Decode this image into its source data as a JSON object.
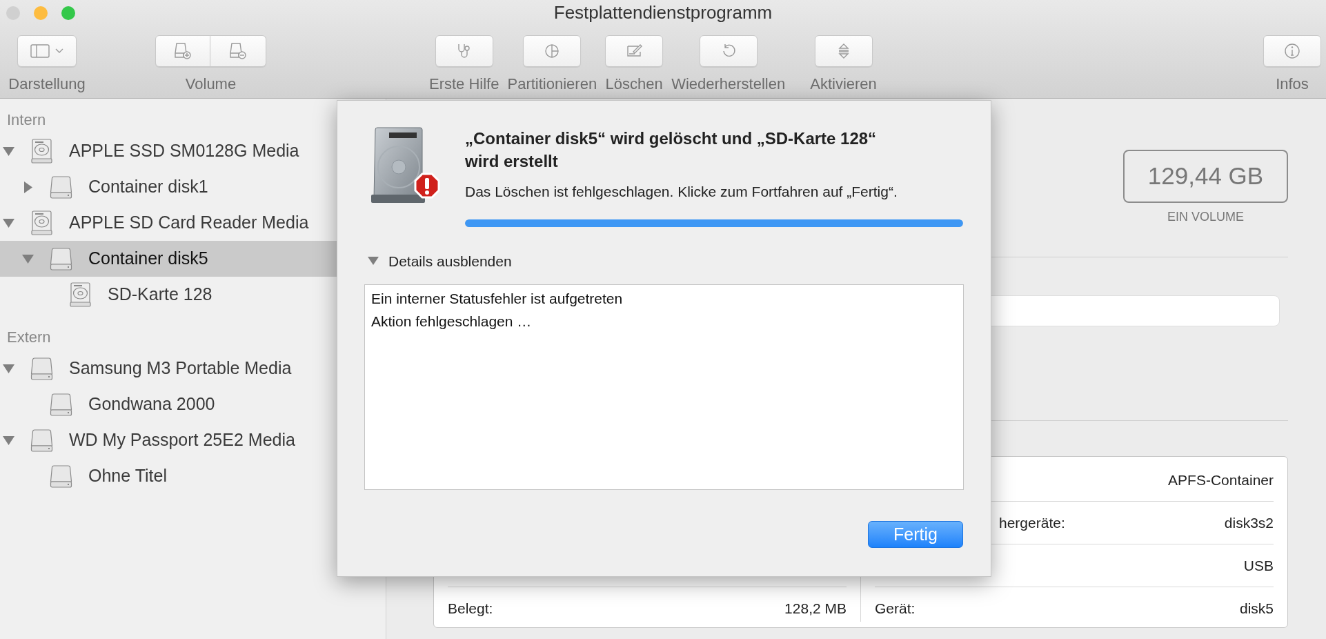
{
  "window": {
    "title": "Festplattendienstprogramm",
    "controls": [
      {
        "color": "#d0d0d0"
      },
      {
        "color": "#fdbc40"
      },
      {
        "color": "#34c84a"
      }
    ]
  },
  "toolbar": {
    "left": [
      {
        "label": "Darstellung",
        "kind": "sidebar"
      },
      {
        "label": "Volume",
        "kind": "volume"
      }
    ],
    "center": [
      {
        "label": "Erste Hilfe",
        "kind": "first-aid"
      },
      {
        "label": "Partitionieren",
        "kind": "partition"
      },
      {
        "label": "Löschen",
        "kind": "erase"
      },
      {
        "label": "Wiederherstellen",
        "kind": "restore"
      },
      {
        "label": "Aktivieren",
        "kind": "mount"
      }
    ],
    "right": [
      {
        "label": "Infos",
        "kind": "info"
      }
    ]
  },
  "sidebar": {
    "sections": [
      {
        "title": "Intern",
        "items": [
          {
            "name": "APPLE SSD SM0128G Media",
            "kind": "disk",
            "selected": false,
            "expanded": true,
            "children": [
              {
                "name": "Container disk1",
                "kind": "volume",
                "selected": false,
                "expanded": false
              }
            ]
          },
          {
            "name": "APPLE SD Card Reader Media",
            "kind": "disk",
            "selected": false,
            "expanded": true,
            "children": [
              {
                "name": "Container disk5",
                "kind": "volume",
                "selected": true,
                "expanded": true,
                "children": [
                  {
                    "name": "SD-Karte 128",
                    "kind": "disk",
                    "selected": false
                  }
                ]
              }
            ]
          }
        ]
      },
      {
        "title": "Extern",
        "items": [
          {
            "name": "Samsung M3 Portable Media",
            "kind": "volume",
            "selected": false,
            "expanded": true,
            "children": [
              {
                "name": "Gondwana 2000",
                "kind": "volume",
                "selected": false
              }
            ]
          },
          {
            "name": "WD My Passport 25E2 Media",
            "kind": "volume",
            "selected": false,
            "expanded": true,
            "children": [
              {
                "name": "Ohne Titel",
                "kind": "volume",
                "selected": false
              }
            ]
          }
        ]
      }
    ]
  },
  "main": {
    "capacity": "129,44 GB",
    "capacity_caption": "EIN VOLUME",
    "info_table": {
      "left_rows": [
        {
          "label": "Belegt:",
          "value": "128,2 MB"
        }
      ],
      "right_rows": [
        {
          "value": "APFS-Container"
        },
        {
          "label": "hergeräte:",
          "value": "disk3s2",
          "clipped": true
        },
        {
          "value": "USB"
        },
        {
          "label": "Gerät:",
          "value": "disk5"
        }
      ]
    }
  },
  "dialog": {
    "title": "„Container disk5“ wird gelöscht und „SD-Karte 128“ wird erstellt",
    "message": "Das Löschen ist fehlgeschlagen. Klicke zum Fortfahren auf „Fertig“.",
    "progress": {
      "level": 1
    },
    "details": {
      "label": "Details ausblenden",
      "expanded": true,
      "lines": [
        "Ein interner Statusfehler ist aufgetreten",
        "Aktion fehlgeschlagen …"
      ]
    },
    "buttons": [
      {
        "label": "Fertig",
        "default": true
      }
    ]
  }
}
